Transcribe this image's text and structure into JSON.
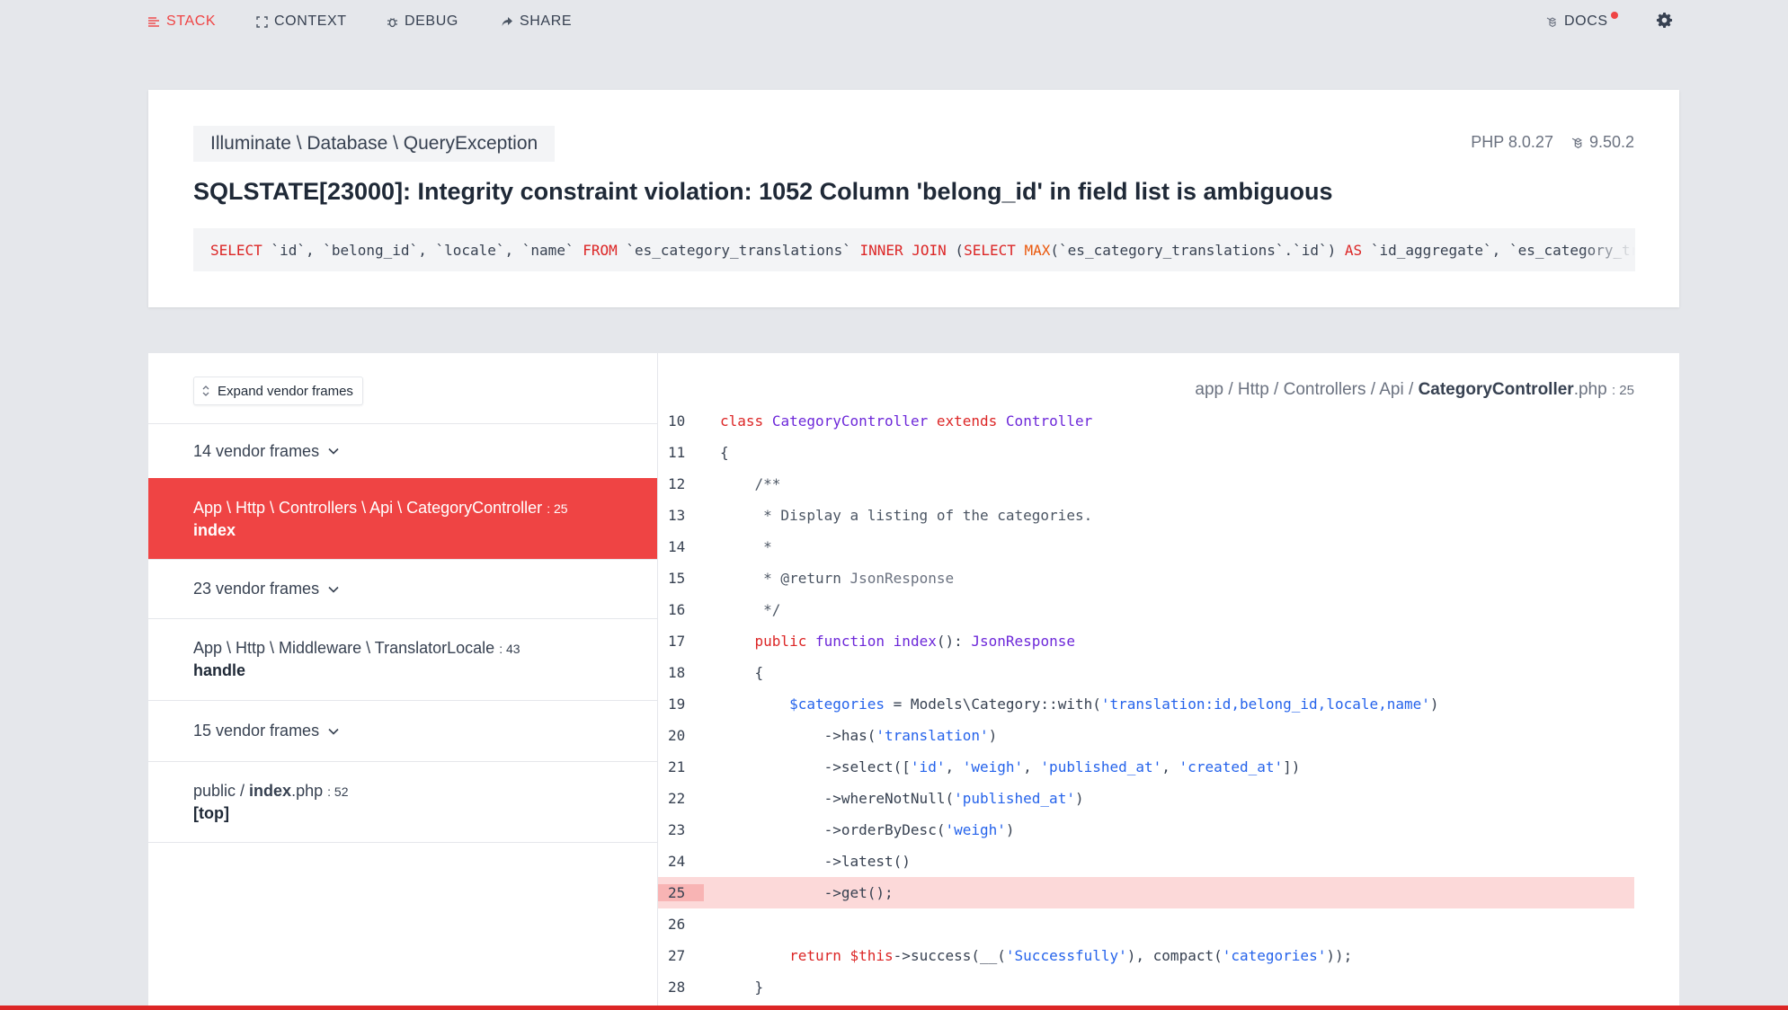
{
  "nav": {
    "stack": "STACK",
    "context": "CONTEXT",
    "debug": "DEBUG",
    "share": "SHARE",
    "docs": "DOCS",
    "icons": {
      "stack": "list-icon",
      "context": "expand-icon",
      "debug": "bug-icon",
      "share": "share-arrow-icon",
      "docs": "laravel-icon",
      "settings": "gear-icon"
    }
  },
  "exception": {
    "class": "Illuminate \\ Database \\ QueryException",
    "php_version": "PHP 8.0.27",
    "laravel_version": "9.50.2",
    "message": "SQLSTATE[23000]: Integrity constraint violation: 1052 Column 'belong_id' in field list is ambiguous",
    "sql": [
      {
        "t": "SELECT",
        "k": "kw"
      },
      {
        "t": " `id`, `belong_id`, `locale`, `name` ",
        "k": ""
      },
      {
        "t": "FROM",
        "k": "kw"
      },
      {
        "t": " `es_category_translations` ",
        "k": ""
      },
      {
        "t": "INNER JOIN",
        "k": "kw"
      },
      {
        "t": " (",
        "k": ""
      },
      {
        "t": "SELECT",
        "k": "kw"
      },
      {
        "t": " ",
        "k": ""
      },
      {
        "t": "MAX",
        "k": "fn"
      },
      {
        "t": "(`es_category_translations`.`id`) ",
        "k": ""
      },
      {
        "t": "AS",
        "k": "kw"
      },
      {
        "t": " `id_aggregate`, `es_category_translations`.`belong_id`",
        "k": ""
      }
    ]
  },
  "frames": {
    "expand_label": "Expand vendor frames",
    "vendor1": "14 vendor frames",
    "app1_path": "App \\ Http \\ Controllers \\ Api \\ CategoryController",
    "app1_line": ": 25",
    "app1_method": "index",
    "vendor2": "23 vendor frames",
    "app2_path": "App \\ Http \\ Middleware \\ TranslatorLocale",
    "app2_line": ": 43",
    "app2_method": "handle",
    "vendor3": "15 vendor frames",
    "app3_dir": "public / ",
    "app3_file": "index",
    "app3_ext": ".php",
    "app3_line": ": 52",
    "app3_method": "[top]"
  },
  "code": {
    "path_prefix": "app / Http / Controllers / Api / ",
    "file_name": "CategoryController",
    "file_ext": ".php",
    "file_line": ": 25",
    "highlight_line": 25,
    "lines": [
      {
        "n": "10",
        "parts": [
          {
            "t": "class",
            "k": "k"
          },
          {
            "t": " ",
            "k": ""
          },
          {
            "t": "CategoryController",
            "k": "c"
          },
          {
            "t": " ",
            "k": ""
          },
          {
            "t": "extends",
            "k": "k"
          },
          {
            "t": " ",
            "k": ""
          },
          {
            "t": "Controller",
            "k": "c"
          }
        ]
      },
      {
        "n": "11",
        "parts": [
          {
            "t": "{",
            "k": ""
          }
        ]
      },
      {
        "n": "12",
        "parts": [
          {
            "t": "    /**",
            "k": "cm"
          }
        ]
      },
      {
        "n": "13",
        "parts": [
          {
            "t": "     * Display a listing of the categories.",
            "k": "cm"
          }
        ]
      },
      {
        "n": "14",
        "parts": [
          {
            "t": "     *",
            "k": "cm"
          }
        ]
      },
      {
        "n": "15",
        "parts": [
          {
            "t": "     * @return ",
            "k": "cm"
          },
          {
            "t": "JsonResponse",
            "k": "cm2"
          }
        ]
      },
      {
        "n": "16",
        "parts": [
          {
            "t": "     */",
            "k": "cm"
          }
        ]
      },
      {
        "n": "17",
        "parts": [
          {
            "t": "    ",
            "k": ""
          },
          {
            "t": "public",
            "k": "k"
          },
          {
            "t": " ",
            "k": ""
          },
          {
            "t": "function",
            "k": "c"
          },
          {
            "t": " ",
            "k": ""
          },
          {
            "t": "index",
            "k": "c"
          },
          {
            "t": "(): ",
            "k": ""
          },
          {
            "t": "JsonResponse",
            "k": "c"
          }
        ]
      },
      {
        "n": "18",
        "parts": [
          {
            "t": "    {",
            "k": ""
          }
        ]
      },
      {
        "n": "19",
        "parts": [
          {
            "t": "        ",
            "k": ""
          },
          {
            "t": "$categories",
            "k": "s"
          },
          {
            "t": " = Models\\Category::with(",
            "k": ""
          },
          {
            "t": "'translation:id,belong_id,locale,name'",
            "k": "s"
          },
          {
            "t": ")",
            "k": ""
          }
        ]
      },
      {
        "n": "20",
        "parts": [
          {
            "t": "            ->has(",
            "k": ""
          },
          {
            "t": "'translation'",
            "k": "s"
          },
          {
            "t": ")",
            "k": ""
          }
        ]
      },
      {
        "n": "21",
        "parts": [
          {
            "t": "            ->select([",
            "k": ""
          },
          {
            "t": "'id'",
            "k": "s"
          },
          {
            "t": ", ",
            "k": ""
          },
          {
            "t": "'weigh'",
            "k": "s"
          },
          {
            "t": ", ",
            "k": ""
          },
          {
            "t": "'published_at'",
            "k": "s"
          },
          {
            "t": ", ",
            "k": ""
          },
          {
            "t": "'created_at'",
            "k": "s"
          },
          {
            "t": "])",
            "k": ""
          }
        ]
      },
      {
        "n": "22",
        "parts": [
          {
            "t": "            ->whereNotNull(",
            "k": ""
          },
          {
            "t": "'published_at'",
            "k": "s"
          },
          {
            "t": ")",
            "k": ""
          }
        ]
      },
      {
        "n": "23",
        "parts": [
          {
            "t": "            ->orderByDesc(",
            "k": ""
          },
          {
            "t": "'weigh'",
            "k": "s"
          },
          {
            "t": ")",
            "k": ""
          }
        ]
      },
      {
        "n": "24",
        "parts": [
          {
            "t": "            ->latest()",
            "k": ""
          }
        ]
      },
      {
        "n": "25",
        "parts": [
          {
            "t": "            ->get();",
            "k": ""
          }
        ]
      },
      {
        "n": "26",
        "parts": [
          {
            "t": "",
            "k": ""
          }
        ]
      },
      {
        "n": "27",
        "parts": [
          {
            "t": "        ",
            "k": ""
          },
          {
            "t": "return",
            "k": "k"
          },
          {
            "t": " ",
            "k": ""
          },
          {
            "t": "$this",
            "k": "k"
          },
          {
            "t": "->success(__(",
            "k": ""
          },
          {
            "t": "'Successfully'",
            "k": "s"
          },
          {
            "t": "), compact(",
            "k": ""
          },
          {
            "t": "'categories'",
            "k": "s"
          },
          {
            "t": "));",
            "k": ""
          }
        ]
      },
      {
        "n": "28",
        "parts": [
          {
            "t": "    }",
            "k": ""
          }
        ]
      }
    ]
  },
  "colors": {
    "accent": "#ef4444",
    "highlight_row": "#fcd9d9",
    "keyword": "#dc2626",
    "class": "#6d28d9",
    "string": "#2563eb"
  }
}
